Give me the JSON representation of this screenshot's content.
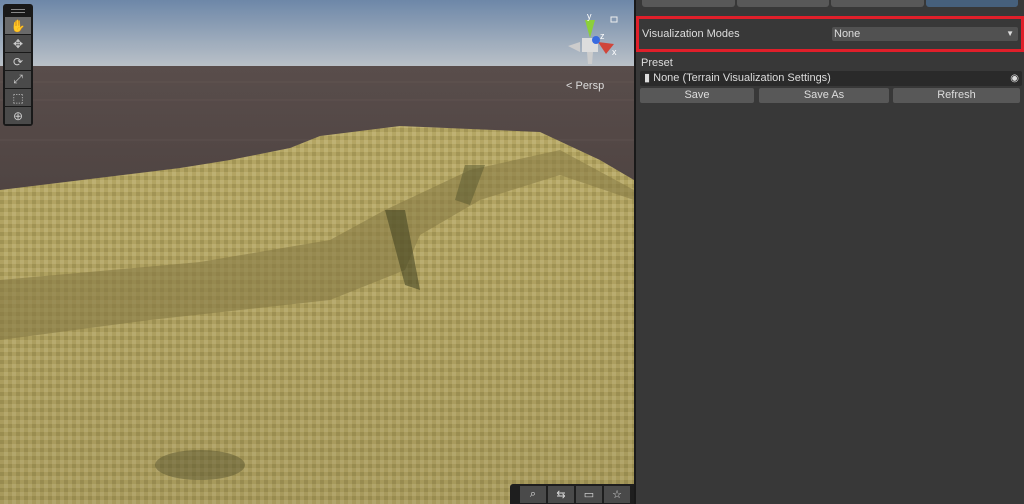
{
  "scene": {
    "tools": [
      {
        "name": "hand",
        "glyph": "✋"
      },
      {
        "name": "move",
        "glyph": "✥"
      },
      {
        "name": "rotate",
        "glyph": "⟳"
      },
      {
        "name": "scale",
        "glyph": "⤢"
      },
      {
        "name": "rect",
        "glyph": "⬚"
      },
      {
        "name": "transform",
        "glyph": "⊕"
      }
    ],
    "projection_label": "< Persp",
    "gizmo": {
      "y": "y",
      "z": "z",
      "x": "x"
    },
    "bottom_tools": [
      {
        "name": "search",
        "glyph": "⌕"
      },
      {
        "name": "camera-orbit",
        "glyph": "⇆"
      },
      {
        "name": "camera",
        "glyph": "▭"
      },
      {
        "name": "favorite",
        "glyph": "☆"
      }
    ],
    "colors": {
      "sky_top": "#6d87a8",
      "sky_horizon": "#b8c0c8",
      "ground": "#4a3e3c",
      "terrain": "#b8a865"
    }
  },
  "inspector": {
    "visualization_modes_label": "Visualization Modes",
    "visualization_modes_value": "None",
    "preset_label": "Preset",
    "preset_value": "None (Terrain Visualization Settings)",
    "buttons": {
      "save": "Save",
      "save_as": "Save As",
      "refresh": "Refresh"
    },
    "highlight_color": "#e01f2a"
  }
}
